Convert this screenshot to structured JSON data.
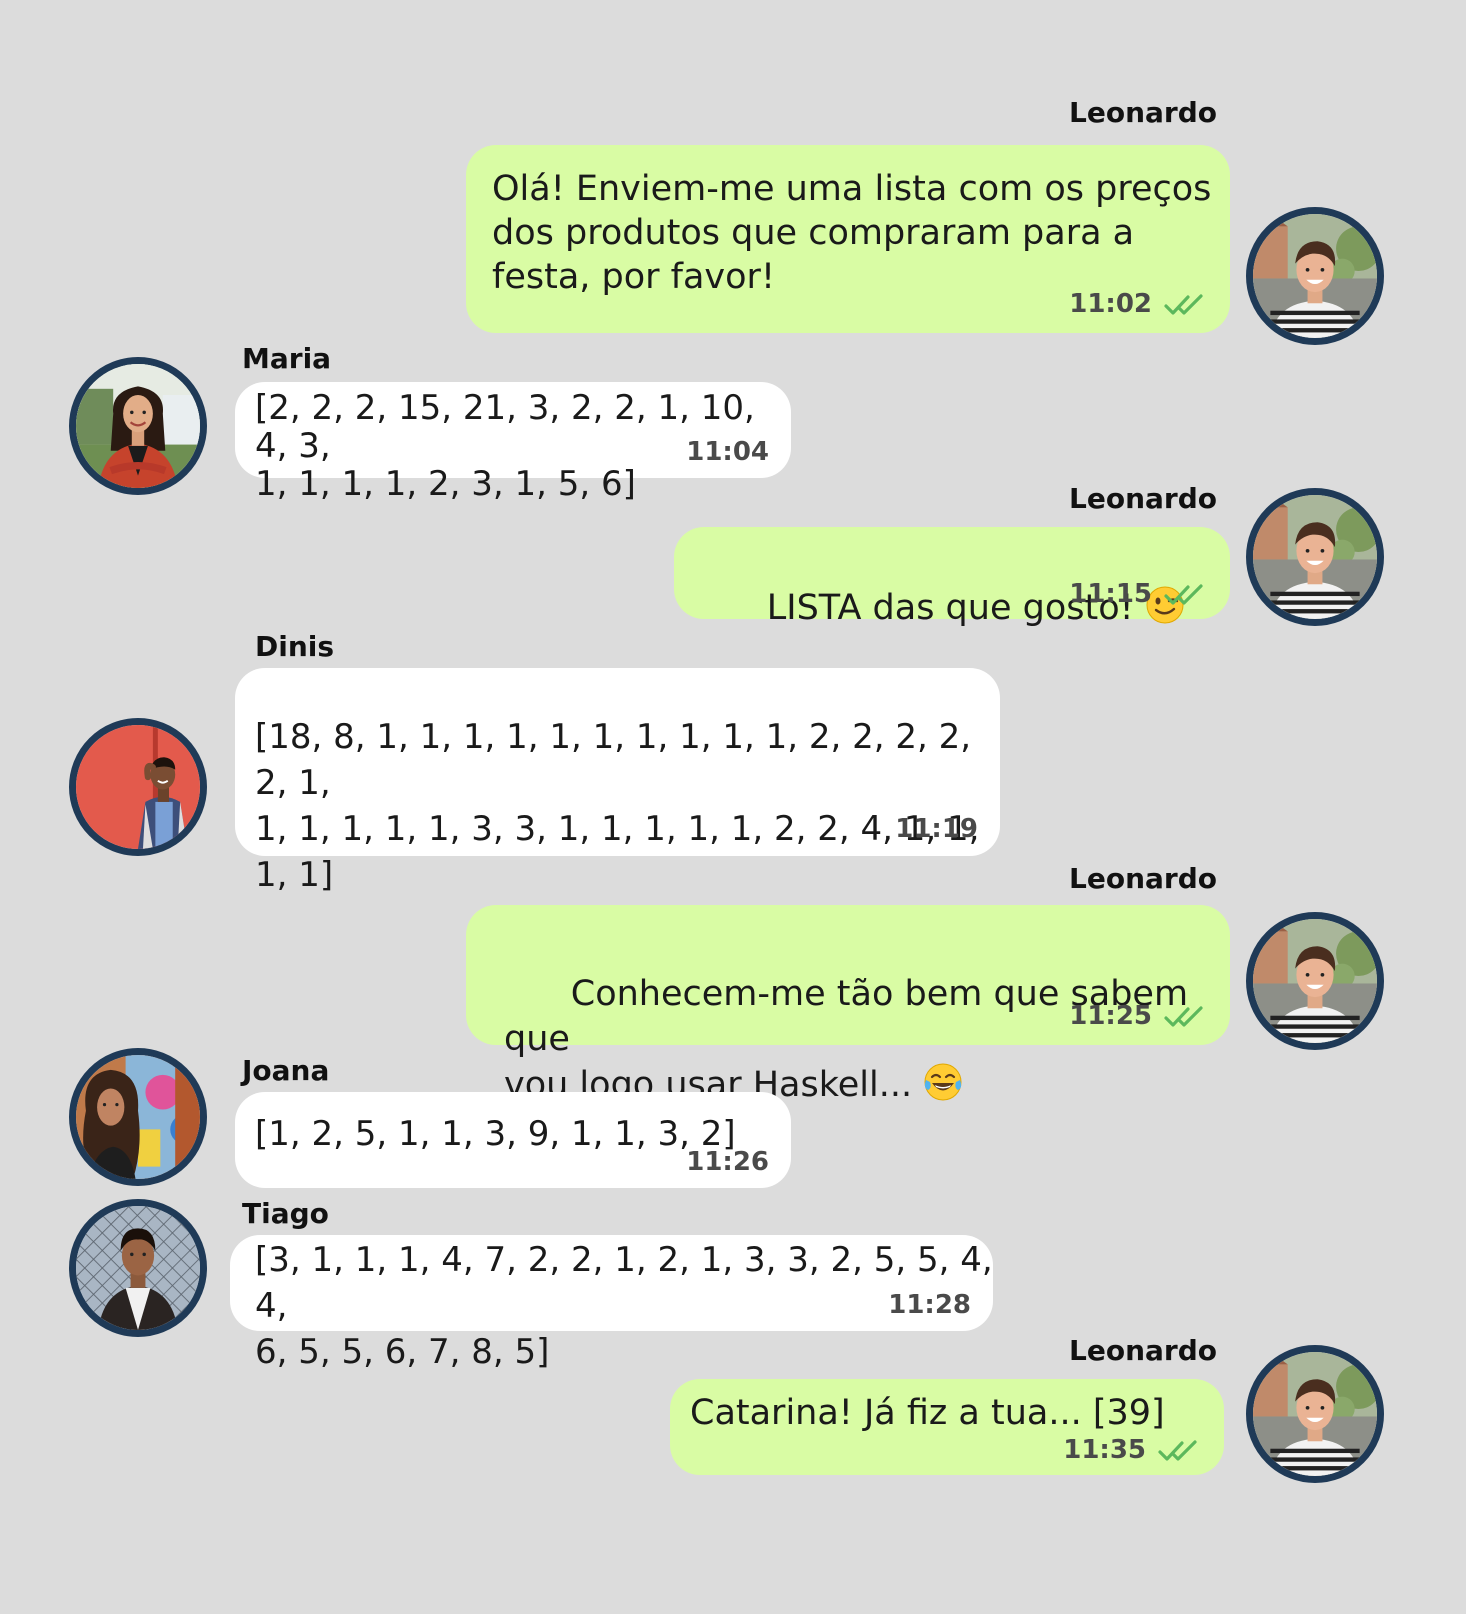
{
  "messages": [
    {
      "sender": "Leonardo",
      "text": "Olá! Enviem-me uma lista com os preços\ndos produtos que compraram para a\nfesta, por favor!",
      "time": "11:02",
      "direction": "out",
      "read_receipt": "double-check-icon"
    },
    {
      "sender": "Maria",
      "text": "[2, 2, 2, 15, 21, 3, 2, 2, 1, 10, 4, 3,\n1, 1, 1, 1, 2, 3, 1, 5, 6]",
      "time": "11:04",
      "direction": "in"
    },
    {
      "sender": "Leonardo",
      "text": "LISTA das que gosto! ",
      "emoji": "winking-face-emoji",
      "time": "11:15",
      "direction": "out",
      "read_receipt": "double-check-icon"
    },
    {
      "sender": "Dinis",
      "text": "[18, 8, 1, 1, 1, 1, 1, 1, 1, 1, 1, 1, 2, 2, 2, 2, 2, 1,\n1, 1, 1, 1, 1, 3, 3, 1, 1, 1, 1, 1, 2, 2, 4, 1, 1, 1, 1]",
      "time": "11:19",
      "direction": "in"
    },
    {
      "sender": "Leonardo",
      "text": "Conhecem-me tão bem que sabem que\nvou logo usar Haskell... ",
      "emoji": "tears-of-joy-emoji",
      "time": "11:25",
      "direction": "out",
      "read_receipt": "double-check-icon"
    },
    {
      "sender": "Joana",
      "text": "[1, 2, 5, 1, 1, 3, 9, 1, 1, 3, 2]",
      "time": "11:26",
      "direction": "in"
    },
    {
      "sender": "Tiago",
      "text": "[3, 1, 1, 1, 4, 7, 2, 2, 1, 2, 1, 3, 3, 2, 5, 5, 4, 4,\n6, 5, 5, 6, 7, 8, 5]",
      "time": "11:28",
      "direction": "in"
    },
    {
      "sender": "Leonardo",
      "text": "Catarina! Já fiz a tua... [39]",
      "time": "11:35",
      "direction": "out",
      "read_receipt": "double-check-icon"
    }
  ],
  "colors": {
    "background": "#dcdcdc",
    "outgoing_bubble": "#d9fca4",
    "incoming_bubble": "#ffffff",
    "avatar_ring": "#1f3a57",
    "check_mark": "#5cb85c"
  }
}
